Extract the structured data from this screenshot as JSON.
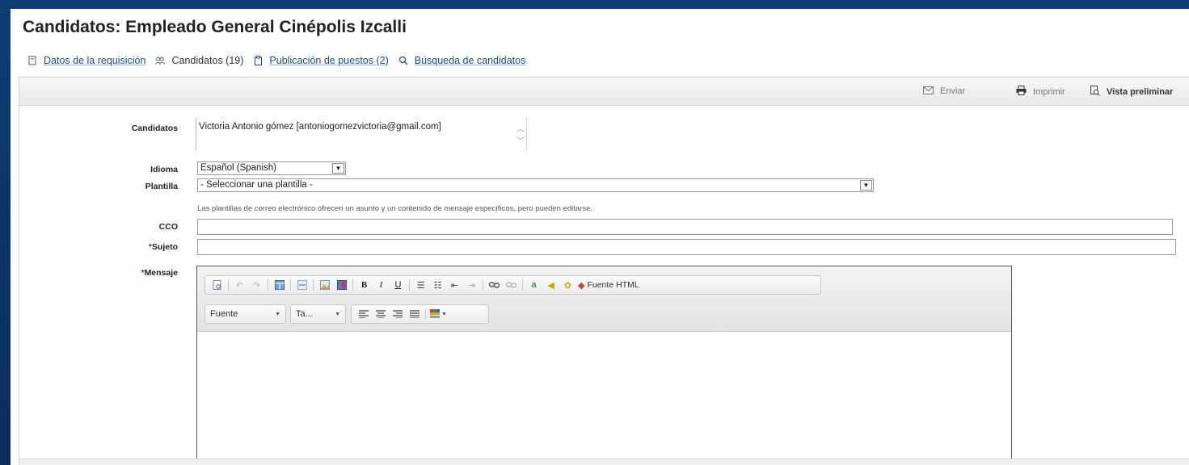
{
  "page": {
    "title": "Candidatos: Empleado General Cinépolis Izcalli"
  },
  "tabs": [
    {
      "label": "Datos de la requisición",
      "icon": "document-icon"
    },
    {
      "label": "Candidatos (19)",
      "icon": "people-icon"
    },
    {
      "label": "Publicación de puestos (2)",
      "icon": "clipboard-icon"
    },
    {
      "label": "Búsqueda de candidatos",
      "icon": "search-icon"
    }
  ],
  "toolbar": {
    "send": "Enviar",
    "print": "Imprimir",
    "preview": "Vista preliminar"
  },
  "form": {
    "candidates_label": "Candidatos",
    "candidates_value": "Victoria Antonio gómez [antoniogomezvictoria@gmail.com]",
    "language_label": "Idioma",
    "language_value": "Español (Spanish)",
    "template_label": "Plantilla",
    "template_value": "- Seleccionar una plantilla -",
    "template_hint": "Las plantillas de correo electrónico ofrecen un asunto y un contenido de mensaje específicos, pero pueden editarse.",
    "cco_label": "CCO",
    "subject_label": "Sujeto",
    "message_label": "Mensaje",
    "required_mark": "*"
  },
  "editor": {
    "html_source": "Fuente HTML",
    "font_combo": "Fuente",
    "size_combo": "Ta..."
  }
}
